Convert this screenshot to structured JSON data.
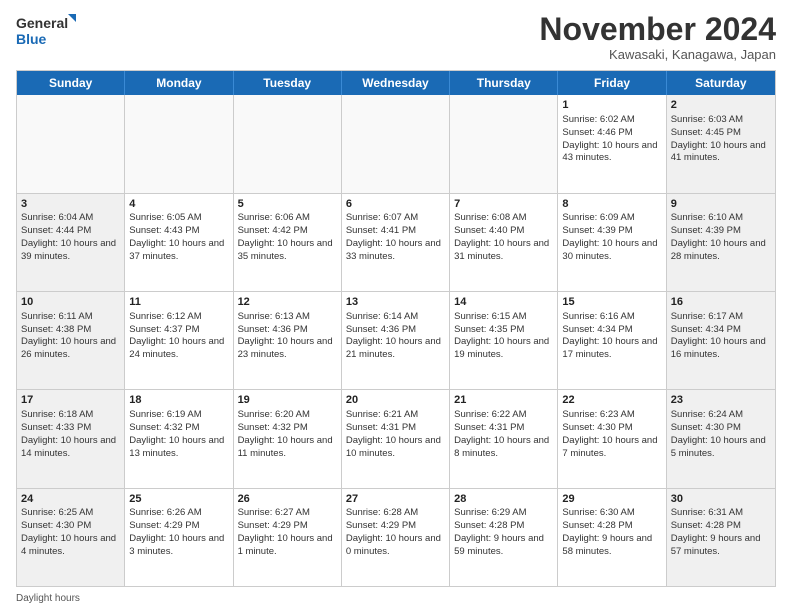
{
  "logo": {
    "line1": "General",
    "line2": "Blue"
  },
  "title": "November 2024",
  "location": "Kawasaki, Kanagawa, Japan",
  "header_days": [
    "Sunday",
    "Monday",
    "Tuesday",
    "Wednesday",
    "Thursday",
    "Friday",
    "Saturday"
  ],
  "footer": "Daylight hours",
  "weeks": [
    [
      {
        "day": "",
        "info": ""
      },
      {
        "day": "",
        "info": ""
      },
      {
        "day": "",
        "info": ""
      },
      {
        "day": "",
        "info": ""
      },
      {
        "day": "",
        "info": ""
      },
      {
        "day": "1",
        "info": "Sunrise: 6:02 AM\nSunset: 4:46 PM\nDaylight: 10 hours and 43 minutes."
      },
      {
        "day": "2",
        "info": "Sunrise: 6:03 AM\nSunset: 4:45 PM\nDaylight: 10 hours and 41 minutes."
      }
    ],
    [
      {
        "day": "3",
        "info": "Sunrise: 6:04 AM\nSunset: 4:44 PM\nDaylight: 10 hours and 39 minutes."
      },
      {
        "day": "4",
        "info": "Sunrise: 6:05 AM\nSunset: 4:43 PM\nDaylight: 10 hours and 37 minutes."
      },
      {
        "day": "5",
        "info": "Sunrise: 6:06 AM\nSunset: 4:42 PM\nDaylight: 10 hours and 35 minutes."
      },
      {
        "day": "6",
        "info": "Sunrise: 6:07 AM\nSunset: 4:41 PM\nDaylight: 10 hours and 33 minutes."
      },
      {
        "day": "7",
        "info": "Sunrise: 6:08 AM\nSunset: 4:40 PM\nDaylight: 10 hours and 31 minutes."
      },
      {
        "day": "8",
        "info": "Sunrise: 6:09 AM\nSunset: 4:39 PM\nDaylight: 10 hours and 30 minutes."
      },
      {
        "day": "9",
        "info": "Sunrise: 6:10 AM\nSunset: 4:39 PM\nDaylight: 10 hours and 28 minutes."
      }
    ],
    [
      {
        "day": "10",
        "info": "Sunrise: 6:11 AM\nSunset: 4:38 PM\nDaylight: 10 hours and 26 minutes."
      },
      {
        "day": "11",
        "info": "Sunrise: 6:12 AM\nSunset: 4:37 PM\nDaylight: 10 hours and 24 minutes."
      },
      {
        "day": "12",
        "info": "Sunrise: 6:13 AM\nSunset: 4:36 PM\nDaylight: 10 hours and 23 minutes."
      },
      {
        "day": "13",
        "info": "Sunrise: 6:14 AM\nSunset: 4:36 PM\nDaylight: 10 hours and 21 minutes."
      },
      {
        "day": "14",
        "info": "Sunrise: 6:15 AM\nSunset: 4:35 PM\nDaylight: 10 hours and 19 minutes."
      },
      {
        "day": "15",
        "info": "Sunrise: 6:16 AM\nSunset: 4:34 PM\nDaylight: 10 hours and 17 minutes."
      },
      {
        "day": "16",
        "info": "Sunrise: 6:17 AM\nSunset: 4:34 PM\nDaylight: 10 hours and 16 minutes."
      }
    ],
    [
      {
        "day": "17",
        "info": "Sunrise: 6:18 AM\nSunset: 4:33 PM\nDaylight: 10 hours and 14 minutes."
      },
      {
        "day": "18",
        "info": "Sunrise: 6:19 AM\nSunset: 4:32 PM\nDaylight: 10 hours and 13 minutes."
      },
      {
        "day": "19",
        "info": "Sunrise: 6:20 AM\nSunset: 4:32 PM\nDaylight: 10 hours and 11 minutes."
      },
      {
        "day": "20",
        "info": "Sunrise: 6:21 AM\nSunset: 4:31 PM\nDaylight: 10 hours and 10 minutes."
      },
      {
        "day": "21",
        "info": "Sunrise: 6:22 AM\nSunset: 4:31 PM\nDaylight: 10 hours and 8 minutes."
      },
      {
        "day": "22",
        "info": "Sunrise: 6:23 AM\nSunset: 4:30 PM\nDaylight: 10 hours and 7 minutes."
      },
      {
        "day": "23",
        "info": "Sunrise: 6:24 AM\nSunset: 4:30 PM\nDaylight: 10 hours and 5 minutes."
      }
    ],
    [
      {
        "day": "24",
        "info": "Sunrise: 6:25 AM\nSunset: 4:30 PM\nDaylight: 10 hours and 4 minutes."
      },
      {
        "day": "25",
        "info": "Sunrise: 6:26 AM\nSunset: 4:29 PM\nDaylight: 10 hours and 3 minutes."
      },
      {
        "day": "26",
        "info": "Sunrise: 6:27 AM\nSunset: 4:29 PM\nDaylight: 10 hours and 1 minute."
      },
      {
        "day": "27",
        "info": "Sunrise: 6:28 AM\nSunset: 4:29 PM\nDaylight: 10 hours and 0 minutes."
      },
      {
        "day": "28",
        "info": "Sunrise: 6:29 AM\nSunset: 4:28 PM\nDaylight: 9 hours and 59 minutes."
      },
      {
        "day": "29",
        "info": "Sunrise: 6:30 AM\nSunset: 4:28 PM\nDaylight: 9 hours and 58 minutes."
      },
      {
        "day": "30",
        "info": "Sunrise: 6:31 AM\nSunset: 4:28 PM\nDaylight: 9 hours and 57 minutes."
      }
    ]
  ]
}
